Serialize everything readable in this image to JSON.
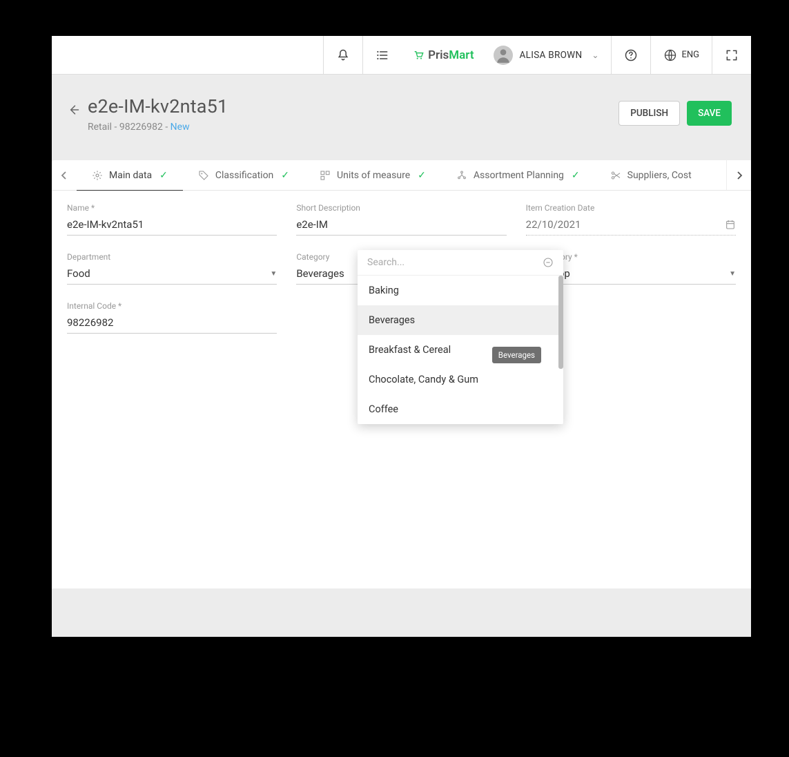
{
  "header": {
    "logo_pris": "Pris",
    "logo_mart": "Mart",
    "user_name": "ALISA BROWN",
    "lang": "ENG"
  },
  "page": {
    "title": "e2e-IM-kv2nta51",
    "breadcrumb_retail": "Retail",
    "breadcrumb_code": "98226982",
    "breadcrumb_status": "New",
    "publish_label": "PUBLISH",
    "save_label": "SAVE"
  },
  "tabs": [
    {
      "label": "Main data"
    },
    {
      "label": "Classification"
    },
    {
      "label": "Units of measure"
    },
    {
      "label": "Assortment Planning"
    },
    {
      "label": "Suppliers, Cost"
    }
  ],
  "form": {
    "name_label": "Name *",
    "name_value": "e2e-IM-kv2nta51",
    "shortdesc_label": "Short Description",
    "shortdesc_value": "e2e-IM",
    "creation_label": "Item Creation Date",
    "creation_value": "22/10/2021",
    "dept_label": "Department",
    "dept_value": "Food",
    "cat_label": "Category",
    "cat_value": "Beverages",
    "subcat_label": "Subcategory *",
    "subcat_value": "Soda Pop",
    "internal_label": "Internal Code *",
    "internal_value": "98226982"
  },
  "dropdown": {
    "search_placeholder": "Search...",
    "tooltip": "Beverages",
    "items": [
      "Baking",
      "Beverages",
      "Breakfast & Cereal",
      "Chocolate, Candy & Gum",
      "Coffee"
    ],
    "selected_index": 1
  }
}
